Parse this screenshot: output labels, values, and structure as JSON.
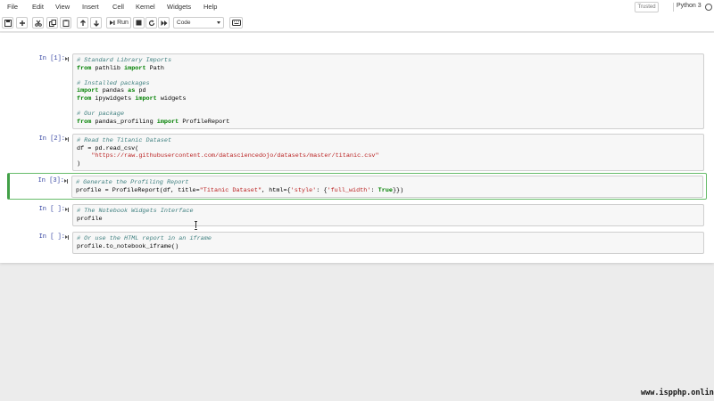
{
  "menubar": {
    "items": [
      {
        "label": "File"
      },
      {
        "label": "Edit"
      },
      {
        "label": "View"
      },
      {
        "label": "Insert"
      },
      {
        "label": "Cell"
      },
      {
        "label": "Kernel"
      },
      {
        "label": "Widgets"
      },
      {
        "label": "Help"
      }
    ],
    "trusted_label": "Trusted",
    "kernel_name": "Python 3"
  },
  "toolbar": {
    "run_label": "Run",
    "cell_type": "Code",
    "icons": [
      "save-icon",
      "plus-icon",
      "cut-icon",
      "copy-icon",
      "paste-icon",
      "arrow-up-icon",
      "arrow-down-icon",
      "step-forward-icon",
      "stop-icon",
      "restart-icon",
      "fast-forward-icon",
      "keyboard-icon"
    ]
  },
  "cells": [
    {
      "prompt": "In [1]:",
      "lines": [
        [
          {
            "t": "# Standard Library Imports",
            "c": "cm-comment"
          }
        ],
        [
          {
            "t": "from",
            "c": "cm-keyword"
          },
          {
            "t": " pathlib "
          },
          {
            "t": "import",
            "c": "cm-keyword"
          },
          {
            "t": " Path"
          }
        ],
        [],
        [
          {
            "t": "# Installed packages",
            "c": "cm-comment"
          }
        ],
        [
          {
            "t": "import",
            "c": "cm-keyword"
          },
          {
            "t": " pandas "
          },
          {
            "t": "as",
            "c": "cm-keyword"
          },
          {
            "t": " pd"
          }
        ],
        [
          {
            "t": "from",
            "c": "cm-keyword"
          },
          {
            "t": " ipywidgets "
          },
          {
            "t": "import",
            "c": "cm-keyword"
          },
          {
            "t": " widgets"
          }
        ],
        [],
        [
          {
            "t": "# Our package",
            "c": "cm-comment"
          }
        ],
        [
          {
            "t": "from",
            "c": "cm-keyword"
          },
          {
            "t": " pandas_profiling "
          },
          {
            "t": "import",
            "c": "cm-keyword"
          },
          {
            "t": " ProfileReport"
          }
        ]
      ]
    },
    {
      "prompt": "In [2]:",
      "lines": [
        [
          {
            "t": "# Read the Titanic Dataset",
            "c": "cm-comment"
          }
        ],
        [
          {
            "t": "df = pd.read_csv("
          }
        ],
        [
          {
            "t": "    "
          },
          {
            "t": "\"https://raw.githubusercontent.com/datasciencedojo/datasets/master/titanic.csv\"",
            "c": "cm-string"
          }
        ],
        [
          {
            "t": ")"
          }
        ]
      ]
    },
    {
      "prompt": "In [3]:",
      "selected": true,
      "lines": [
        [
          {
            "t": "# Generate the Profiling Report",
            "c": "cm-comment"
          }
        ],
        [
          {
            "t": "profile = ProfileReport(df, title="
          },
          {
            "t": "\"Titanic Dataset\"",
            "c": "cm-string"
          },
          {
            "t": ", html={"
          },
          {
            "t": "'style'",
            "c": "cm-string"
          },
          {
            "t": ": {"
          },
          {
            "t": "'full_width'",
            "c": "cm-string"
          },
          {
            "t": ": "
          },
          {
            "t": "True",
            "c": "cm-keyword"
          },
          {
            "t": "}})"
          }
        ]
      ]
    },
    {
      "prompt": "In [ ]:",
      "lines": [
        [
          {
            "t": "# The Notebook Widgets Interface",
            "c": "cm-comment"
          }
        ],
        [
          {
            "t": "profile"
          }
        ]
      ]
    },
    {
      "prompt": "In [ ]:",
      "lines": [
        [
          {
            "t": "# Or use the HTML report in an iframe",
            "c": "cm-comment"
          }
        ],
        [
          {
            "t": "profile.to_notebook_iframe()"
          }
        ]
      ]
    }
  ],
  "watermark": "www.ispphp.online"
}
